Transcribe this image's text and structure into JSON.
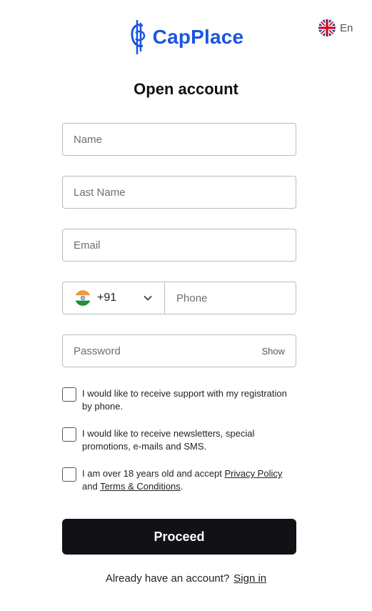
{
  "brand": {
    "name": "CapPlace",
    "color": "#1a56e0"
  },
  "language": {
    "label": "En",
    "flag_icon": "uk-flag-icon"
  },
  "form": {
    "title": "Open account",
    "name_placeholder": "Name",
    "last_name_placeholder": "Last Name",
    "email_placeholder": "Email",
    "phone": {
      "country_code": "+91",
      "country_flag_icon": "india-flag-icon",
      "placeholder": "Phone"
    },
    "password_placeholder": "Password",
    "show_label": "Show",
    "checkboxes": {
      "support": {
        "text": "I would like to receive support with my registration by phone.",
        "checked": false
      },
      "newsletter": {
        "text": "I would like to receive newsletters, special promotions, e-mails and SMS.",
        "checked": false
      },
      "age": {
        "prefix": "I am over 18 years old and accept ",
        "privacy_link": "Privacy Policy",
        "middle": "and ",
        "terms_link": "Terms & Conditions",
        "suffix": ".",
        "checked": false
      }
    },
    "proceed_label": "Proceed"
  },
  "footer": {
    "prompt": "Already have an account?",
    "signin_label": "Sign in"
  },
  "colors": {
    "button_bg": "#121216",
    "border": "#b9bcc2"
  }
}
